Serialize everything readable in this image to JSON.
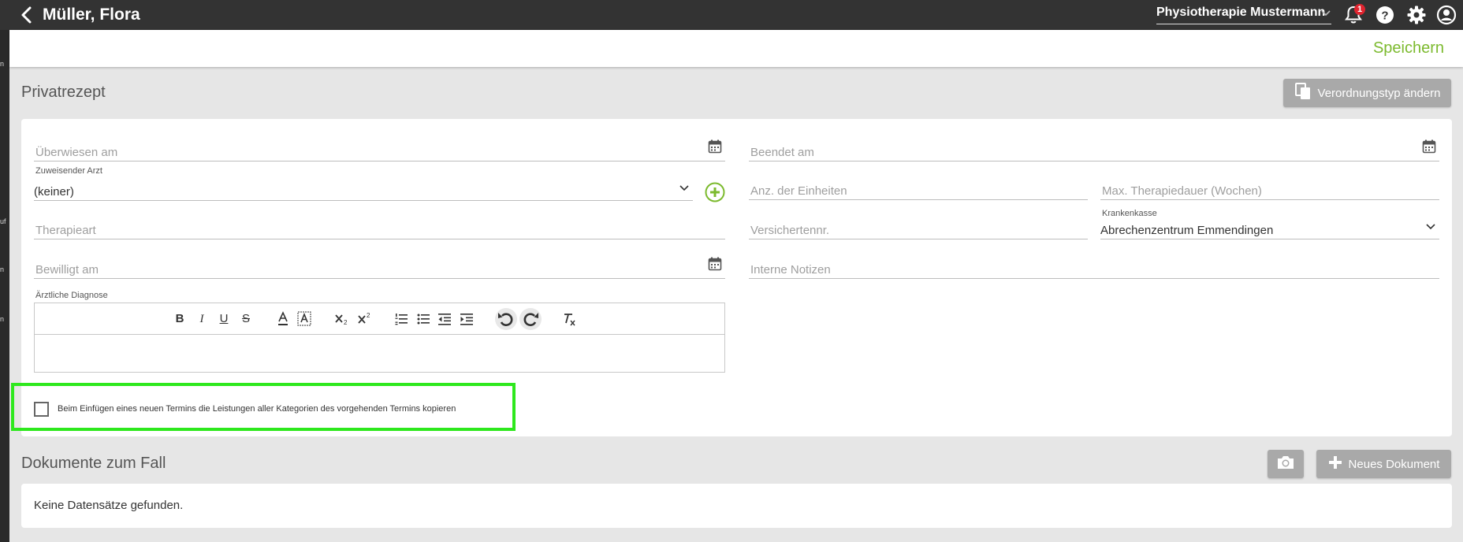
{
  "header": {
    "patient_name": "Müller, Flora",
    "practice": "Physiotherapie Mustermann",
    "notification_count": "1"
  },
  "toolbar": {
    "save_label": "Speichern"
  },
  "left_strip": [
    "n",
    "uf",
    "n",
    "n"
  ],
  "prescription": {
    "title": "Privatrezept",
    "change_type_label": "Verordnungstyp ändern",
    "fields": {
      "ueberwiesen_am": {
        "placeholder": "Überwiesen am"
      },
      "beendet_am": {
        "placeholder": "Beendet am"
      },
      "zuweisender_arzt": {
        "label": "Zuweisender Arzt",
        "value": "(keiner)"
      },
      "anz_einheiten": {
        "placeholder": "Anz. der Einheiten"
      },
      "max_therapiedauer": {
        "placeholder": "Max. Therapiedauer (Wochen)"
      },
      "therapieart": {
        "placeholder": "Therapieart"
      },
      "versichertennr": {
        "placeholder": "Versichertennr."
      },
      "krankenkasse": {
        "label": "Krankenkasse",
        "value": "Abrechenzentrum Emmendingen"
      },
      "bewilligt_am": {
        "placeholder": "Bewilligt am"
      },
      "interne_notizen": {
        "placeholder": "Interne Notizen"
      }
    },
    "diagnose": {
      "label": "Ärztliche Diagnose"
    },
    "copy_checkbox": {
      "label": "Beim Einfügen eines neuen Termins die Leistungen aller Kategorien des vorgehenden Termins kopieren",
      "checked": false
    }
  },
  "documents": {
    "title": "Dokumente zum Fall",
    "new_document_label": "Neues Dokument",
    "empty_text": "Keine Datensätze gefunden."
  },
  "colors": {
    "accent_green": "#7cba2e",
    "highlight_green": "#2ee81d",
    "topbar": "#333333",
    "badge_red": "#e0242f"
  }
}
